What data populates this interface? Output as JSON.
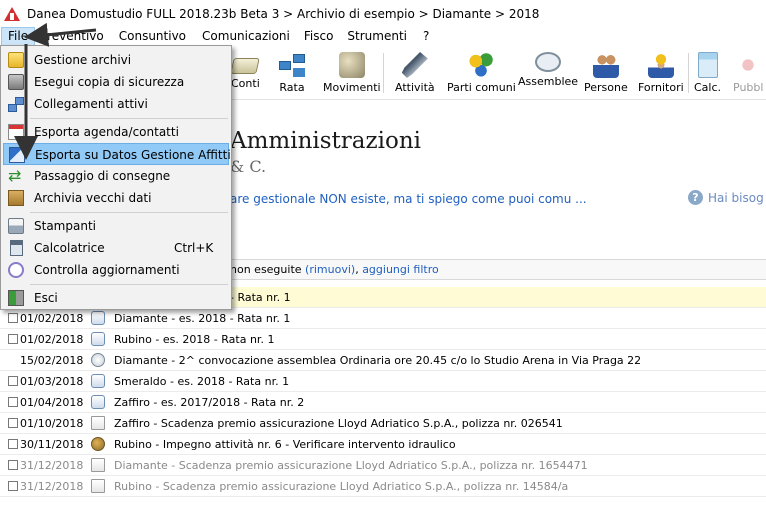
{
  "window": {
    "title": "Danea Domustudio FULL 2018.23b Beta 3 > Archivio di esempio > Diamante > 2018"
  },
  "menubar": {
    "items": [
      {
        "label": "File"
      },
      {
        "label": "Preventivo"
      },
      {
        "label": "Consuntivo"
      },
      {
        "label": "Comunicazioni"
      },
      {
        "label": "Fisco"
      },
      {
        "label": "Strumenti"
      },
      {
        "label": "?"
      }
    ]
  },
  "toolbar": {
    "buttons": [
      {
        "label": "Conti",
        "icon": "conti-icon"
      },
      {
        "label": "Rata",
        "icon": "rata-icon"
      },
      {
        "label": "Movimenti",
        "icon": "movimenti-icon"
      },
      {
        "label": "Attività",
        "icon": "drill-icon"
      },
      {
        "label": "Parti comuni",
        "icon": "parti-comuni-icon"
      },
      {
        "label": "Assemblee",
        "icon": "speech-bubble-icon"
      },
      {
        "label": "Persone",
        "icon": "people-icon"
      },
      {
        "label": "Fornitori",
        "icon": "worker-icon"
      },
      {
        "label": "Calc.",
        "icon": "calculator-icon"
      },
      {
        "label": "Pubbl",
        "icon": "publish-icon"
      }
    ]
  },
  "content": {
    "title": "Amministrazioni",
    "subtitle": "& C.",
    "link": "are gestionale NON esiste, ma ti spiego come puoi comu ...",
    "help": "Hai bisog"
  },
  "filterbar": {
    "prefix": "non eseguite ",
    "remove_link": "(rimuovi)",
    "separator": ", ",
    "add_filter_link": "aggiungi filtro"
  },
  "list": {
    "highlight_row": "- Rata nr. 1",
    "rows": [
      {
        "date": "01/02/2018",
        "desc": "Diamante - es. 2018 - Rata nr. 1",
        "check": true
      },
      {
        "date": "01/02/2018",
        "desc": "Rubino - es. 2018 - Rata nr. 1",
        "check": true
      },
      {
        "date": "15/02/2018",
        "desc": "Diamante - 2^ convocazione assemblea Ordinaria ore 20.45 c/o lo Studio Arena in Via Praga 22",
        "check": false
      },
      {
        "date": "01/03/2018",
        "desc": "Smeraldo - es. 2018 - Rata nr. 1",
        "check": true
      },
      {
        "date": "01/04/2018",
        "desc": "Zaffiro - es. 2017/2018 - Rata nr. 2",
        "check": true
      },
      {
        "date": "01/10/2018",
        "desc": "Zaffiro - Scadenza premio assicurazione Lloyd Adriatico S.p.A., polizza nr. 026541",
        "check": true
      },
      {
        "date": "30/11/2018",
        "desc": "Rubino - Impegno attività nr. 6 - Verificare intervento idraulico",
        "check": true
      },
      {
        "date": "31/12/2018",
        "desc": "Diamante - Scadenza premio assicurazione Lloyd Adriatico S.p.A., polizza nr. 1654471",
        "check": true
      },
      {
        "date": "31/12/2018",
        "desc": "Rubino - Scadenza premio assicurazione Lloyd Adriatico S.p.A., polizza nr. 14584/a",
        "check": true
      }
    ]
  },
  "file_menu": {
    "items": [
      {
        "label": "Gestione archivi",
        "icon": "folder-icon"
      },
      {
        "label": "Esegui copia di sicurezza",
        "icon": "backup-icon"
      },
      {
        "label": "Collegamenti attivi",
        "icon": "network-icon"
      },
      {
        "label": "Esporta agenda/contatti",
        "icon": "calendar-icon"
      },
      {
        "label": "Esporta su Datos Gestione Affitti",
        "icon": "export-icon",
        "selected": true
      },
      {
        "label": "Passaggio di consegne",
        "icon": "handover-icon"
      },
      {
        "label": "Archivia vecchi dati",
        "icon": "archive-box-icon"
      },
      {
        "label": "Stampanti",
        "icon": "printer-icon"
      },
      {
        "label": "Calcolatrice",
        "shortcut": "Ctrl+K",
        "icon": "calculator-icon"
      },
      {
        "label": "Controlla aggiornamenti",
        "icon": "update-icon"
      },
      {
        "label": "Esci",
        "icon": "exit-icon"
      }
    ]
  }
}
